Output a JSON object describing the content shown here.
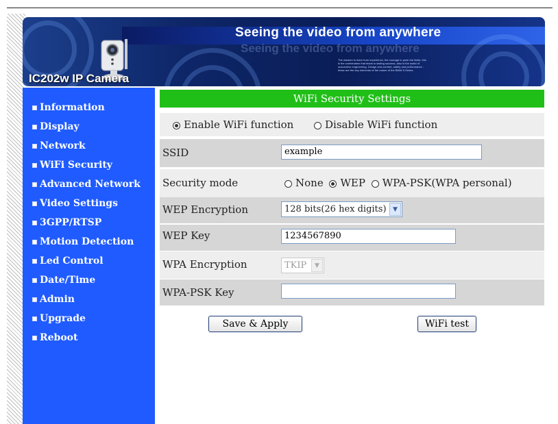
{
  "header": {
    "model": "IC202w IP Camera",
    "tagline": "Seeing the video from anywhere",
    "fine_print": "The wisdom to learn from experience, the courage to push the limits, this is the combination that leads to lasting success, also in the world of automotive engineering. Design and comfort, safety and performance - these are the key elements of the nature of the BMW 5 Series."
  },
  "sidebar": {
    "items": [
      {
        "label": "Information"
      },
      {
        "label": "Display"
      },
      {
        "label": "Network"
      },
      {
        "label": "WiFi Security"
      },
      {
        "label": "Advanced Network"
      },
      {
        "label": "Video Settings"
      },
      {
        "label": "3GPP/RTSP"
      },
      {
        "label": "Motion Detection"
      },
      {
        "label": "Led Control"
      },
      {
        "label": "Date/Time"
      },
      {
        "label": "Admin"
      },
      {
        "label": "Upgrade"
      },
      {
        "label": "Reboot"
      }
    ]
  },
  "panel": {
    "title": "WiFi Security Settings",
    "wifi_function": {
      "enable_label": "Enable WiFi function",
      "disable_label": "Disable WiFi function",
      "selected": "enable"
    },
    "ssid": {
      "label": "SSID",
      "value": "example"
    },
    "security_mode": {
      "label": "Security mode",
      "options": [
        "None",
        "WEP",
        "WPA-PSK(WPA personal)"
      ],
      "selected": "WEP"
    },
    "wep_encryption": {
      "label": "WEP Encryption",
      "value": "128 bits(26 hex digits)"
    },
    "wep_key": {
      "label": "WEP Key",
      "value": "1234567890"
    },
    "wpa_encryption": {
      "label": "WPA Encryption",
      "value": "TKIP",
      "disabled": true
    },
    "wpa_psk_key": {
      "label": "WPA-PSK Key",
      "value": ""
    },
    "buttons": {
      "save": "Save & Apply",
      "test": "WiFi test"
    }
  }
}
